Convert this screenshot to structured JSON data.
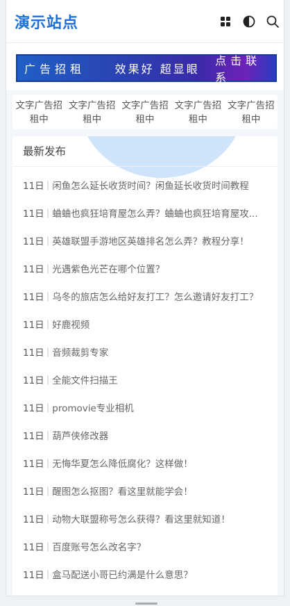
{
  "header": {
    "logo": "演示站点",
    "icons": [
      "grid-icon",
      "contrast-icon",
      "search-icon"
    ]
  },
  "banner": {
    "part1": "广告招租",
    "part2": "效果好 超显眼",
    "part3": "点击联系"
  },
  "text_ads": [
    "文字广告招租中",
    "文字广告招租中",
    "文字广告招租中",
    "文字广告招租中",
    "文字广告招租中"
  ],
  "latest": {
    "heading": "最新发布",
    "items": [
      {
        "date": "11日",
        "title": "闲鱼怎么延长收货时间？闲鱼延长收货时间教程"
      },
      {
        "date": "11日",
        "title": "蛐蛐也疯狂培育屋怎么弄？蛐蛐也疯狂培育屋攻..."
      },
      {
        "date": "11日",
        "title": "英雄联盟手游地区英雄排名怎么弄？教程分享！"
      },
      {
        "date": "11日",
        "title": "光遇紫色光芒在哪个位置？"
      },
      {
        "date": "11日",
        "title": "乌冬的旅店怎么给好友打工？怎么邀请好友打工？"
      },
      {
        "date": "11日",
        "title": "好鹿视频"
      },
      {
        "date": "11日",
        "title": "音频裁剪专家"
      },
      {
        "date": "11日",
        "title": "全能文件扫描王"
      },
      {
        "date": "11日",
        "title": "promovie专业相机"
      },
      {
        "date": "11日",
        "title": "葫芦侠修改器"
      },
      {
        "date": "11日",
        "title": "无悔华夏怎么降低腐化？这样做！"
      },
      {
        "date": "11日",
        "title": "醒图怎么抠图？看这里就能学会！"
      },
      {
        "date": "11日",
        "title": "动物大联盟称号怎么获得？看这里就知道！"
      },
      {
        "date": "11日",
        "title": "百度账号怎么改名字？"
      },
      {
        "date": "11日",
        "title": "盒马配送小哥已约满是什么意思？"
      }
    ]
  },
  "colors": {
    "brand": "#1e6fd9",
    "banner_start": "#1f5fc4",
    "banner_end": "#6e22b8"
  }
}
